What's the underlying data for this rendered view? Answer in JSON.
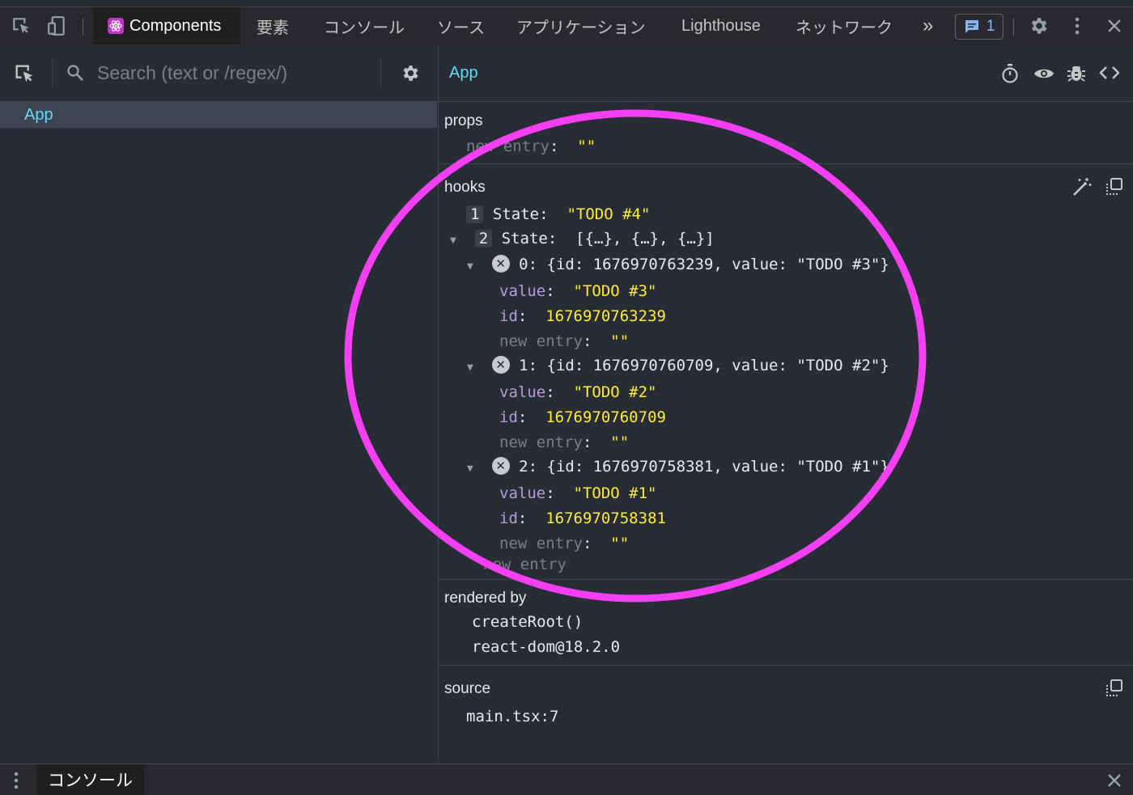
{
  "toolbar": {
    "tabs": [
      "Components",
      "要素",
      "コンソール",
      "ソース",
      "アプリケーション",
      "Lighthouse",
      "ネットワーク"
    ],
    "more_label": "»",
    "issues_count": "1"
  },
  "left_panel": {
    "search_placeholder": "Search (text or /regex/)",
    "tree": [
      "App"
    ]
  },
  "right_panel": {
    "component_name": "App",
    "props": {
      "title": "props",
      "new_entry_key": "new entry",
      "new_entry_value": "\"\""
    },
    "hooks": {
      "title": "hooks",
      "state1": {
        "index": "1",
        "label": "State:",
        "value": "\"TODO #4\""
      },
      "state2": {
        "index": "2",
        "label": "State:",
        "value": "[{…}, {…}, {…}]"
      },
      "items": [
        {
          "key": "0:",
          "summary": "{id: 1676970763239, value: \"TODO #3\"}",
          "value": "\"TODO #3\"",
          "id": "1676970763239"
        },
        {
          "key": "1:",
          "summary": "{id: 1676970760709, value: \"TODO #2\"}",
          "value": "\"TODO #2\"",
          "id": "1676970760709"
        },
        {
          "key": "2:",
          "summary": "{id: 1676970758381, value: \"TODO #1\"}",
          "value": "\"TODO #1\"",
          "id": "1676970758381"
        }
      ],
      "value_key": "value",
      "id_key": "id",
      "new_entry_key": "new entry",
      "new_entry_value": "\"\"",
      "new_entry_label": "new entry"
    },
    "rendered_by": {
      "title": "rendered by",
      "items": [
        "createRoot()",
        "react-dom@18.2.0"
      ]
    },
    "source": {
      "title": "source",
      "file": "main.tsx:7"
    }
  },
  "drawer": {
    "tab_label": "コンソール"
  },
  "colors": {
    "highlight_ring": "#f53ff5",
    "accent": "#61dafb",
    "string": "#ffeb3b",
    "key": "#b39ddb"
  }
}
